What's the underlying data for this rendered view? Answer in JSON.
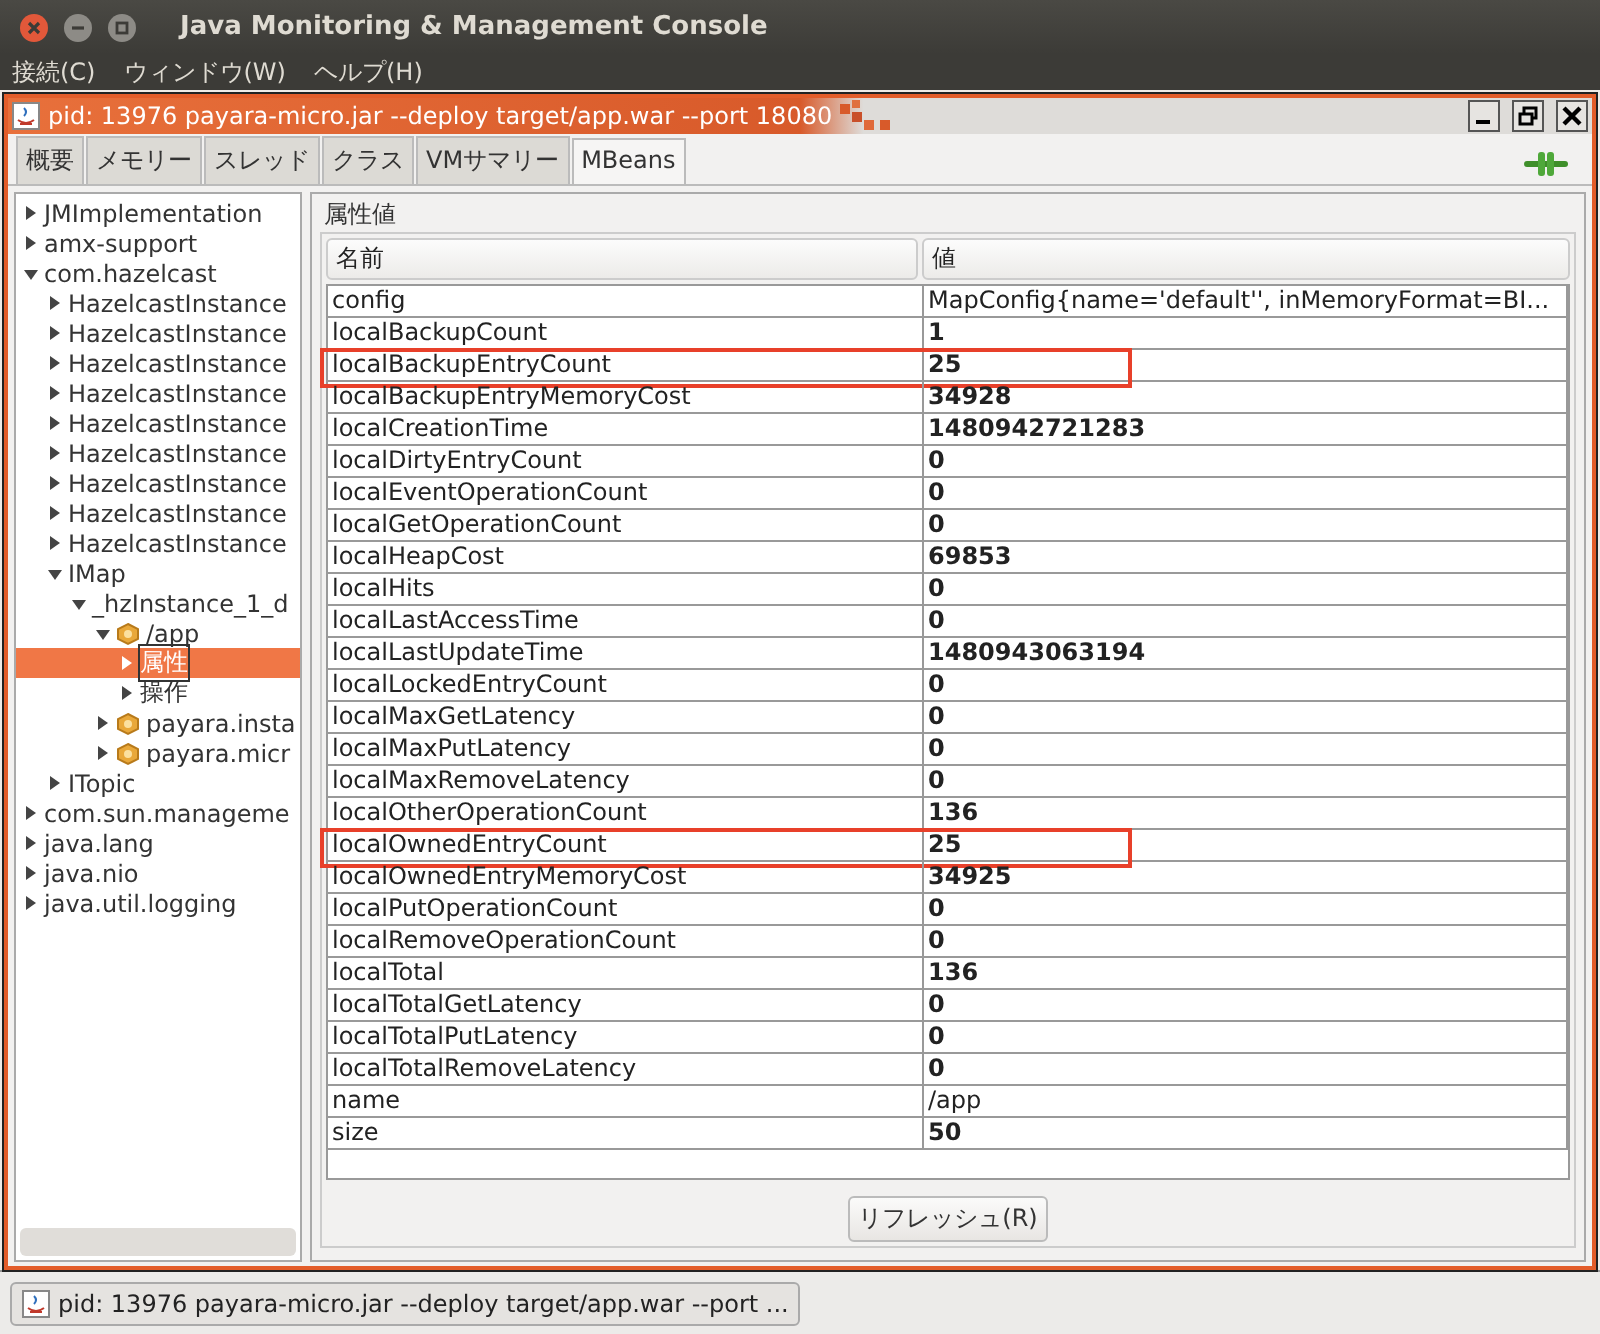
{
  "window": {
    "title": "Java Monitoring & Management Console"
  },
  "menu": [
    "接続(C)",
    "ウィンドウ(W)",
    "ヘルプ(H)"
  ],
  "frame": {
    "title": "pid: 13976 payara-micro.jar --deploy target/app.war --port 18080"
  },
  "tabs": [
    {
      "label": "概要",
      "selected": false
    },
    {
      "label": "メモリー",
      "selected": false
    },
    {
      "label": "スレッド",
      "selected": false
    },
    {
      "label": "クラス",
      "selected": false
    },
    {
      "label": "VMサマリー",
      "selected": false
    },
    {
      "label": "MBeans",
      "selected": true
    }
  ],
  "tree": [
    {
      "label": "JMImplementation",
      "expanded": false,
      "selected": false
    },
    {
      "label": "amx-support",
      "expanded": false,
      "selected": false
    },
    {
      "label": "com.hazelcast",
      "expanded": true,
      "selected": false,
      "children": [
        {
          "label": "HazelcastInstance",
          "expanded": false,
          "selected": false
        },
        {
          "label": "HazelcastInstance",
          "expanded": false,
          "selected": false
        },
        {
          "label": "HazelcastInstance",
          "expanded": false,
          "selected": false
        },
        {
          "label": "HazelcastInstance",
          "expanded": false,
          "selected": false
        },
        {
          "label": "HazelcastInstance",
          "expanded": false,
          "selected": false
        },
        {
          "label": "HazelcastInstance",
          "expanded": false,
          "selected": false
        },
        {
          "label": "HazelcastInstance",
          "expanded": false,
          "selected": false
        },
        {
          "label": "HazelcastInstance",
          "expanded": false,
          "selected": false
        },
        {
          "label": "HazelcastInstance",
          "expanded": false,
          "selected": false
        },
        {
          "label": "IMap",
          "expanded": true,
          "selected": false,
          "children": [
            {
              "label": "_hzInstance_1_d",
              "expanded": true,
              "selected": false,
              "children": [
                {
                  "label": "/app",
                  "kind": "bean",
                  "expanded": true,
                  "selected": false,
                  "children": [
                    {
                      "label": "属性",
                      "expanded": false,
                      "selected": true
                    },
                    {
                      "label": "操作",
                      "expanded": false,
                      "selected": false
                    }
                  ]
                },
                {
                  "label": "payara.insta",
                  "kind": "bean",
                  "expanded": false,
                  "selected": false
                },
                {
                  "label": "payara.micr",
                  "kind": "bean",
                  "expanded": false,
                  "selected": false
                }
              ]
            }
          ]
        },
        {
          "label": "ITopic",
          "expanded": false,
          "selected": false
        }
      ]
    },
    {
      "label": "com.sun.manageme",
      "expanded": false,
      "selected": false
    },
    {
      "label": "java.lang",
      "expanded": false,
      "selected": false
    },
    {
      "label": "java.nio",
      "expanded": false,
      "selected": false
    },
    {
      "label": "java.util.logging",
      "expanded": false,
      "selected": false
    }
  ],
  "attributes": {
    "title": "属性値",
    "columns": [
      "名前",
      "値"
    ],
    "rows": [
      {
        "name": "config",
        "value": "MapConfig{name='default'', inMemoryFormat=BI...",
        "kind": "text",
        "highlighted": false
      },
      {
        "name": "localBackupCount",
        "value": "1",
        "kind": "number",
        "highlighted": false
      },
      {
        "name": "localBackupEntryCount",
        "value": "25",
        "kind": "number",
        "highlighted": true
      },
      {
        "name": "localBackupEntryMemoryCost",
        "value": "34928",
        "kind": "number",
        "highlighted": false
      },
      {
        "name": "localCreationTime",
        "value": "1480942721283",
        "kind": "number",
        "highlighted": false
      },
      {
        "name": "localDirtyEntryCount",
        "value": "0",
        "kind": "number",
        "highlighted": false
      },
      {
        "name": "localEventOperationCount",
        "value": "0",
        "kind": "number",
        "highlighted": false
      },
      {
        "name": "localGetOperationCount",
        "value": "0",
        "kind": "number",
        "highlighted": false
      },
      {
        "name": "localHeapCost",
        "value": "69853",
        "kind": "number",
        "highlighted": false
      },
      {
        "name": "localHits",
        "value": "0",
        "kind": "number",
        "highlighted": false
      },
      {
        "name": "localLastAccessTime",
        "value": "0",
        "kind": "number",
        "highlighted": false
      },
      {
        "name": "localLastUpdateTime",
        "value": "1480943063194",
        "kind": "number",
        "highlighted": false
      },
      {
        "name": "localLockedEntryCount",
        "value": "0",
        "kind": "number",
        "highlighted": false
      },
      {
        "name": "localMaxGetLatency",
        "value": "0",
        "kind": "number",
        "highlighted": false
      },
      {
        "name": "localMaxPutLatency",
        "value": "0",
        "kind": "number",
        "highlighted": false
      },
      {
        "name": "localMaxRemoveLatency",
        "value": "0",
        "kind": "number",
        "highlighted": false
      },
      {
        "name": "localOtherOperationCount",
        "value": "136",
        "kind": "number",
        "highlighted": false
      },
      {
        "name": "localOwnedEntryCount",
        "value": "25",
        "kind": "number",
        "highlighted": true
      },
      {
        "name": "localOwnedEntryMemoryCost",
        "value": "34925",
        "kind": "number",
        "highlighted": false
      },
      {
        "name": "localPutOperationCount",
        "value": "0",
        "kind": "number",
        "highlighted": false
      },
      {
        "name": "localRemoveOperationCount",
        "value": "0",
        "kind": "number",
        "highlighted": false
      },
      {
        "name": "localTotal",
        "value": "136",
        "kind": "number",
        "highlighted": false
      },
      {
        "name": "localTotalGetLatency",
        "value": "0",
        "kind": "number",
        "highlighted": false
      },
      {
        "name": "localTotalPutLatency",
        "value": "0",
        "kind": "number",
        "highlighted": false
      },
      {
        "name": "localTotalRemoveLatency",
        "value": "0",
        "kind": "number",
        "highlighted": false
      },
      {
        "name": "name",
        "value": "/app",
        "kind": "text",
        "highlighted": false
      },
      {
        "name": "size",
        "value": "50",
        "kind": "number",
        "highlighted": false
      }
    ],
    "refresh_button": "リフレッシュ(R)"
  },
  "taskbar": {
    "item": "pid: 13976 payara-micro.jar --deploy target/app.war --port ..."
  }
}
